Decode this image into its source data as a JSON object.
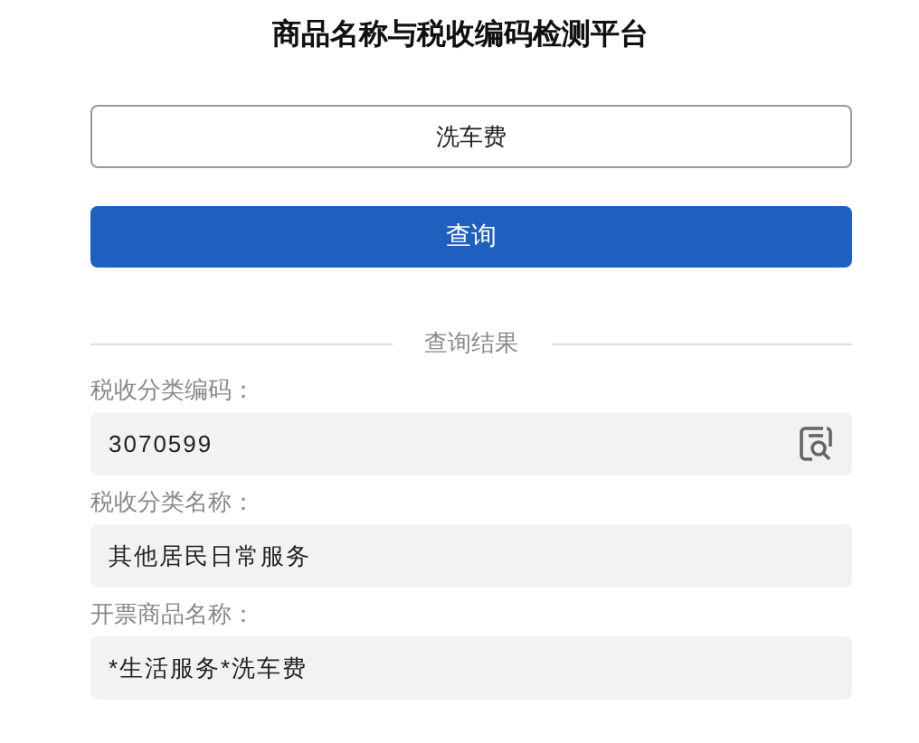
{
  "title": "商品名称与税收编码检测平台",
  "search": {
    "value": "洗车费"
  },
  "query_button": "查询",
  "results_divider": "查询结果",
  "results": [
    {
      "label": "税收分类编码：",
      "value": "3070599",
      "kind": "lookup"
    },
    {
      "label": "税收分类名称：",
      "value": "其他居民日常服务",
      "kind": "plain"
    },
    {
      "label": "开票商品名称：",
      "value": "*生活服务*洗车费",
      "kind": "plain"
    }
  ]
}
